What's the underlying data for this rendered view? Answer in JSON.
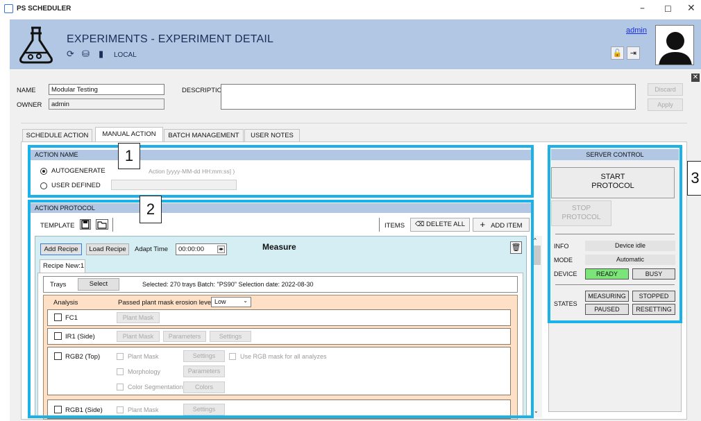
{
  "window": {
    "title": "PS SCHEDULER",
    "minimize": "–",
    "maximize": "☐",
    "close": "✕"
  },
  "header": {
    "title": "EXPERIMENTS - EXPERIMENT DETAIL",
    "location": "LOCAL",
    "user": "admin"
  },
  "form": {
    "name_label": "NAME",
    "name_value": "Modular Testing",
    "owner_label": "OWNER",
    "owner_value": "admin",
    "description_label": "DESCRIPTION",
    "description_value": "",
    "discard": "Discard",
    "apply": "Apply"
  },
  "tabs": [
    "SCHEDULE ACTION",
    "MANUAL ACTION",
    "BATCH MANAGEMENT",
    "USER NOTES"
  ],
  "callouts": [
    "1",
    "2",
    "3"
  ],
  "action_name": {
    "header": "ACTION NAME",
    "autogenerate": "AUTOGENERATE",
    "autogenerate_hint": "Action [yyyy-MM-dd  HH:mm:ss] )",
    "user_defined": "USER DEFINED",
    "user_defined_value": ""
  },
  "protocol": {
    "header": "ACTION PROTOCOL",
    "template": "TEMPLATE",
    "items": "ITEMS",
    "delete_all": "DELETE ALL",
    "add_item": "ADD ITEM",
    "add_recipe": "Add Recipe",
    "load_recipe": "Load Recipe",
    "adapt_time": "Adapt Time",
    "time_value": "00:00:00",
    "measure": "Measure",
    "recipe_tab": "Recipe New:1",
    "trays": "Trays",
    "select": "Select",
    "tray_info": "Selected: 270 trays   Batch: \"PS90\"   Selection date: 2022-08-30",
    "analysis": "Analysis",
    "erosion_label": "Passed plant mask erosion level:",
    "erosion_value": "Low",
    "fc1": "FC1",
    "ir1": "IR1 (Side)",
    "rgb2": "RGB2 (Top)",
    "rgb1": "RGB1 (Side)",
    "plant_mask": "Plant Mask",
    "parameters": "Parameters",
    "settings": "Settings",
    "morphology": "Morphology",
    "color_segmentation": "Color Segmentation",
    "colors": "Colors",
    "use_rgb_mask": "Use RGB mask for all analyzes"
  },
  "server": {
    "header": "SERVER CONTROL",
    "start": "START PROTOCOL",
    "stop": "STOP PROTOCOL",
    "info_label": "INFO",
    "info_value": "Device idle",
    "mode_label": "MODE",
    "mode_value": "Automatic",
    "device_label": "DEVICE",
    "ready": "READY",
    "busy": "BUSY",
    "states_label": "STATES",
    "measuring": "MEASURING",
    "stopped": "STOPPED",
    "paused": "PAUSED",
    "resetting": "RESETTING"
  },
  "colors": {
    "accent_blue": "#1bb1e9",
    "header_blue": "#b1c7e4",
    "ready_green": "#7ce57a",
    "measure_bg": "#d5eef3",
    "analysis_orange": "#fde0c6"
  }
}
